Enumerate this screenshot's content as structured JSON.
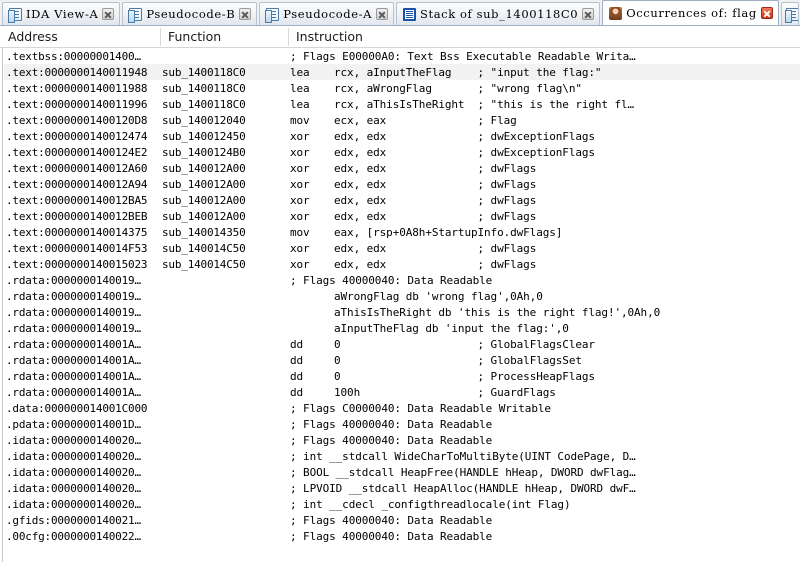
{
  "window": {
    "active_tab": "Occurrences of: flag"
  },
  "tabs": [
    {
      "label": "IDA View-A",
      "icon": "document-icon",
      "active": false,
      "close": "close-icon"
    },
    {
      "label": "Pseudocode-B",
      "icon": "document-icon",
      "active": false,
      "close": "close-icon"
    },
    {
      "label": "Pseudocode-A",
      "icon": "document-icon",
      "active": false,
      "close": "close-icon"
    },
    {
      "label": "Stack of sub_1400118C0",
      "icon": "stack-icon",
      "active": false,
      "close": "close-icon"
    },
    {
      "label": "Occurrences of: flag",
      "icon": "person-search-icon",
      "active": true,
      "close": "close-icon-red"
    }
  ],
  "columns": {
    "address": "Address",
    "function": "Function",
    "instruction": "Instruction"
  },
  "colors": {
    "highlight_row": "#f2f2f2",
    "tab_border": "#9dafc4",
    "close_red": "#cf2c10",
    "text": "#000000"
  },
  "rows": [
    {
      "address": ".textbss:00000001400…",
      "function": "",
      "mnemonic": "",
      "operands": "",
      "comment": "; Flags E00000A0: Text Bss Executable Readable Writa…",
      "highlight": false
    },
    {
      "address": ".text:0000000140011948",
      "function": "sub_1400118C0",
      "mnemonic": "lea",
      "operands": "rcx, aInputTheFlag",
      "comment": "; \"input the flag:\"",
      "highlight": true
    },
    {
      "address": ".text:0000000140011988",
      "function": "sub_1400118C0",
      "mnemonic": "lea",
      "operands": "rcx, aWrongFlag",
      "comment": "; \"wrong flag\\n\"",
      "highlight": false
    },
    {
      "address": ".text:0000000140011996",
      "function": "sub_1400118C0",
      "mnemonic": "lea",
      "operands": "rcx, aThisIsTheRight",
      "comment": "; \"this is the right fl…",
      "highlight": false
    },
    {
      "address": ".text:00000001400120D8",
      "function": "sub_140012040",
      "mnemonic": "mov",
      "operands": "ecx, eax",
      "comment": "; Flag",
      "highlight": false
    },
    {
      "address": ".text:0000000140012474",
      "function": "sub_140012450",
      "mnemonic": "xor",
      "operands": "edx, edx",
      "comment": "; dwExceptionFlags",
      "highlight": false
    },
    {
      "address": ".text:00000001400124E2",
      "function": "sub_1400124B0",
      "mnemonic": "xor",
      "operands": "edx, edx",
      "comment": "; dwExceptionFlags",
      "highlight": false
    },
    {
      "address": ".text:0000000140012A60",
      "function": "sub_140012A00",
      "mnemonic": "xor",
      "operands": "edx, edx",
      "comment": "; dwFlags",
      "highlight": false
    },
    {
      "address": ".text:0000000140012A94",
      "function": "sub_140012A00",
      "mnemonic": "xor",
      "operands": "edx, edx",
      "comment": "; dwFlags",
      "highlight": false
    },
    {
      "address": ".text:0000000140012BA5",
      "function": "sub_140012A00",
      "mnemonic": "xor",
      "operands": "edx, edx",
      "comment": "; dwFlags",
      "highlight": false
    },
    {
      "address": ".text:0000000140012BEB",
      "function": "sub_140012A00",
      "mnemonic": "xor",
      "operands": "edx, edx",
      "comment": "; dwFlags",
      "highlight": false
    },
    {
      "address": ".text:0000000140014375",
      "function": "sub_140014350",
      "mnemonic": "mov",
      "operands": "eax, [rsp+0A8h+StartupInfo.dwFlags]",
      "comment": "",
      "highlight": false
    },
    {
      "address": ".text:0000000140014F53",
      "function": "sub_140014C50",
      "mnemonic": "xor",
      "operands": "edx, edx",
      "comment": "; dwFlags",
      "highlight": false
    },
    {
      "address": ".text:0000000140015023",
      "function": "sub_140014C50",
      "mnemonic": "xor",
      "operands": "edx, edx",
      "comment": "; dwFlags",
      "highlight": false
    },
    {
      "address": ".rdata:0000000140019…",
      "function": "",
      "mnemonic": "",
      "operands": "",
      "comment": "; Flags 40000040: Data Readable",
      "highlight": false
    },
    {
      "address": ".rdata:0000000140019…",
      "function": "",
      "mnemonic": "",
      "operands": "aWrongFlag db 'wrong flag',0Ah,0",
      "comment": "",
      "highlight": false
    },
    {
      "address": ".rdata:0000000140019…",
      "function": "",
      "mnemonic": "",
      "operands": "aThisIsTheRight db 'this is the right flag!',0Ah,0",
      "comment": "",
      "highlight": false
    },
    {
      "address": ".rdata:0000000140019…",
      "function": "",
      "mnemonic": "",
      "operands": "aInputTheFlag db 'input the flag:',0",
      "comment": "",
      "highlight": false
    },
    {
      "address": ".rdata:000000014001A…",
      "function": "",
      "mnemonic": "dd",
      "operands": "0",
      "comment": "; GlobalFlagsClear",
      "highlight": false
    },
    {
      "address": ".rdata:000000014001A…",
      "function": "",
      "mnemonic": "dd",
      "operands": "0",
      "comment": "; GlobalFlagsSet",
      "highlight": false
    },
    {
      "address": ".rdata:000000014001A…",
      "function": "",
      "mnemonic": "dd",
      "operands": "0",
      "comment": "; ProcessHeapFlags",
      "highlight": false
    },
    {
      "address": ".rdata:000000014001A…",
      "function": "",
      "mnemonic": "dd",
      "operands": "100h",
      "comment": "; GuardFlags",
      "highlight": false
    },
    {
      "address": ".data:000000014001C000",
      "function": "",
      "mnemonic": "",
      "operands": "",
      "comment": "; Flags C0000040: Data Readable Writable",
      "highlight": false
    },
    {
      "address": ".pdata:000000014001D…",
      "function": "",
      "mnemonic": "",
      "operands": "",
      "comment": "; Flags 40000040: Data Readable",
      "highlight": false
    },
    {
      "address": ".idata:0000000140020…",
      "function": "",
      "mnemonic": "",
      "operands": "",
      "comment": "; Flags 40000040: Data Readable",
      "highlight": false
    },
    {
      "address": ".idata:0000000140020…",
      "function": "",
      "mnemonic": "",
      "operands": "",
      "comment": "; int __stdcall WideCharToMultiByte(UINT CodePage, D…",
      "highlight": false
    },
    {
      "address": ".idata:0000000140020…",
      "function": "",
      "mnemonic": "",
      "operands": "",
      "comment": "; BOOL __stdcall HeapFree(HANDLE hHeap, DWORD dwFlag…",
      "highlight": false
    },
    {
      "address": ".idata:0000000140020…",
      "function": "",
      "mnemonic": "",
      "operands": "",
      "comment": "; LPVOID __stdcall HeapAlloc(HANDLE hHeap, DWORD dwF…",
      "highlight": false
    },
    {
      "address": ".idata:0000000140020…",
      "function": "",
      "mnemonic": "",
      "operands": "",
      "comment": "; int __cdecl _configthreadlocale(int Flag)",
      "highlight": false
    },
    {
      "address": ".gfids:0000000140021…",
      "function": "",
      "mnemonic": "",
      "operands": "",
      "comment": "; Flags 40000040: Data Readable",
      "highlight": false
    },
    {
      "address": ".00cfg:0000000140022…",
      "function": "",
      "mnemonic": "",
      "operands": "",
      "comment": "; Flags 40000040: Data Readable",
      "highlight": false
    }
  ]
}
